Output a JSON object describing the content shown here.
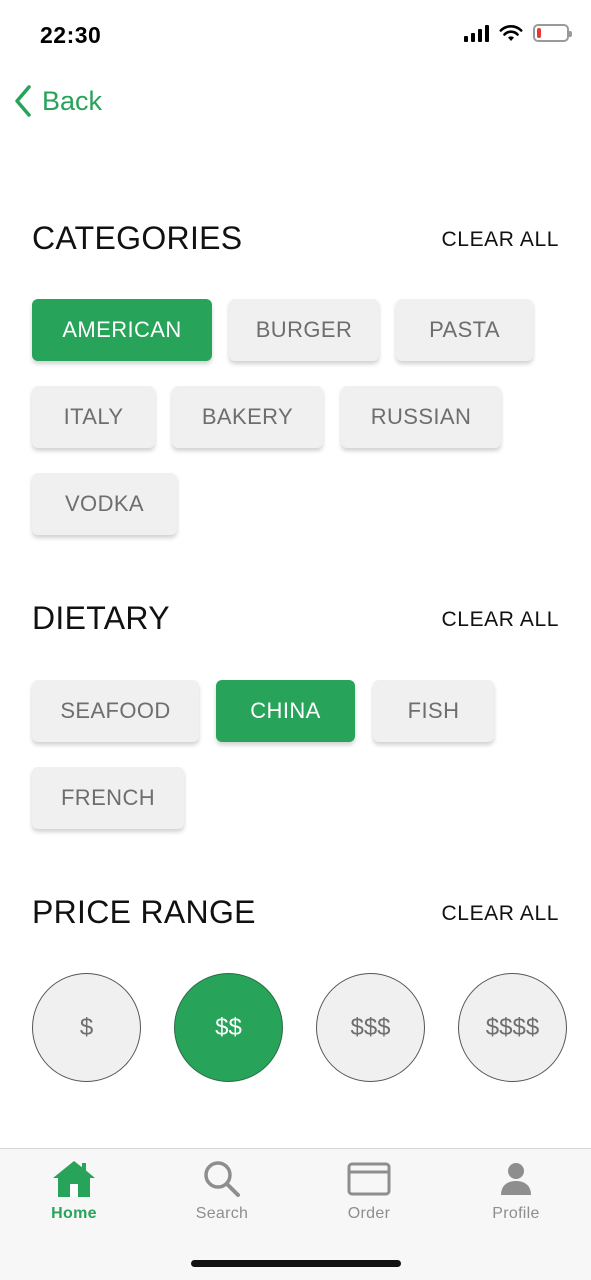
{
  "status_bar": {
    "time": "22:30",
    "icons": [
      "signal-icon",
      "wifi-icon",
      "battery-low-icon"
    ],
    "battery_level": 0.15
  },
  "nav": {
    "back_label": "Back",
    "back_icon": "chevron-left-icon"
  },
  "sections": {
    "categories": {
      "title": "CATEGORIES",
      "clear_label": "CLEAR ALL",
      "chips": [
        {
          "label": "AMERICAN",
          "selected": true
        },
        {
          "label": "BURGER",
          "selected": false
        },
        {
          "label": "PASTA",
          "selected": false
        },
        {
          "label": "ITALY",
          "selected": false
        },
        {
          "label": "BAKERY",
          "selected": false
        },
        {
          "label": "RUSSIAN",
          "selected": false
        },
        {
          "label": "VODKA",
          "selected": false
        }
      ]
    },
    "dietary": {
      "title": "DIETARY",
      "clear_label": "CLEAR ALL",
      "chips": [
        {
          "label": "SEAFOOD",
          "selected": false
        },
        {
          "label": "CHINA",
          "selected": true
        },
        {
          "label": "FISH",
          "selected": false
        },
        {
          "label": "FRENCH",
          "selected": false
        }
      ]
    },
    "price_range": {
      "title": "PRICE RANGE",
      "clear_label": "CLEAR ALL",
      "options": [
        {
          "label": "$",
          "selected": false
        },
        {
          "label": "$$",
          "selected": true
        },
        {
          "label": "$$$",
          "selected": false
        },
        {
          "label": "$$$$",
          "selected": false
        }
      ]
    }
  },
  "tab_bar": {
    "tabs": [
      {
        "label": "Home",
        "icon": "home-icon",
        "active": true
      },
      {
        "label": "Search",
        "icon": "search-icon",
        "active": false
      },
      {
        "label": "Order",
        "icon": "order-icon",
        "active": false
      },
      {
        "label": "Profile",
        "icon": "profile-icon",
        "active": false
      }
    ]
  },
  "colors": {
    "accent": "#27a35a",
    "chip_background": "#f0f0f0",
    "chip_text": "#6e6e6e",
    "battery_low": "#e53935"
  }
}
